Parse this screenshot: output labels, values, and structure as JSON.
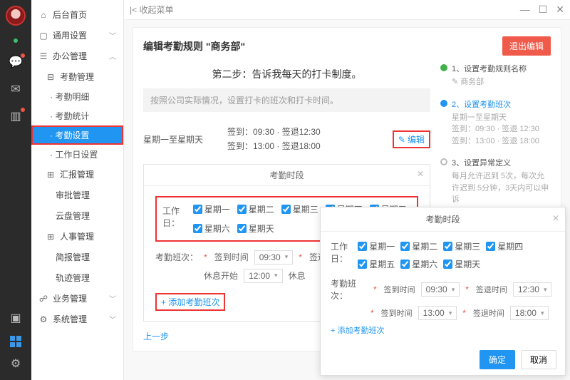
{
  "titlebar": {
    "app": "|< 收起菜单"
  },
  "rail": {
    "icons": [
      "chat",
      "mail",
      "stats"
    ],
    "bottom": [
      "user",
      "apps",
      "gear"
    ]
  },
  "sidebar": {
    "home": "后台首页",
    "groups": [
      {
        "label": "通用设置",
        "icon": "▢",
        "open": false
      },
      {
        "label": "办公管理",
        "icon": "☰",
        "open": true,
        "children": [
          {
            "label": "考勤管理",
            "icon": "⊕",
            "open": true,
            "subs": [
              {
                "label": "· 考勤明细"
              },
              {
                "label": "· 考勤统计"
              },
              {
                "label": "· 考勤设置",
                "active": true
              },
              {
                "label": "· 工作日设置"
              }
            ]
          },
          {
            "label": "汇报管理",
            "icon": "⊕"
          },
          {
            "label": "审批管理"
          },
          {
            "label": "云盘管理"
          },
          {
            "label": "人事管理",
            "icon": "⊕"
          },
          {
            "label": "简报管理"
          },
          {
            "label": "轨迹管理"
          }
        ]
      },
      {
        "label": "业务管理",
        "icon": "☍",
        "open": false
      },
      {
        "label": "系统管理",
        "icon": "⚙",
        "open": false
      }
    ]
  },
  "panel": {
    "title": "编辑考勤规则 \"商务部\"",
    "exit": "退出编辑",
    "stepTitle": "第二步：告诉我每天的打卡制度。",
    "hint": "按照公司实际情况，设置打卡的班次和打卡时间。",
    "dayRange": "星期一至星期天",
    "times": "签到：09:30 · 签退12:30\n签到：13:00 · 签退18:00",
    "editLabel": "编辑",
    "prev": "上一步"
  },
  "inner": {
    "header": "考勤时段",
    "workdaysLabel": "工作日：",
    "days": [
      "星期一",
      "星期二",
      "星期三",
      "星期四",
      "星期五",
      "星期六",
      "星期天"
    ],
    "shiftLabel": "考勤班次：",
    "signin": "签到时间",
    "signout": "签退",
    "rest": "休息开始",
    "t1": "09:30",
    "t2": "12:00",
    "add": "+ 添加考勤班次"
  },
  "steps": [
    {
      "num": "1、设置考勤规则名称",
      "detail": "✎ 商务部",
      "state": "done"
    },
    {
      "num": "2、设置考勤班次",
      "detail": "星期一至星期天\n签到：09:30 · 签退 12:30\n签到：13:00 · 签退 18:00",
      "state": "cur"
    },
    {
      "num": "3、设置异常定义",
      "detail": "每月允许迟到 5次，每次允许迟到 5分钟，3天内可以申诉\n迟到、早退……",
      "state": ""
    }
  ],
  "modal": {
    "header": "考勤时段",
    "workdaysLabel": "工作日：",
    "days": [
      "星期一",
      "星期二",
      "星期三",
      "星期四",
      "星期五",
      "星期六",
      "星期天"
    ],
    "shiftLabel": "考勤班次：",
    "signin": "签到时间",
    "signout": "签退时间",
    "r1a": "09:30",
    "r1b": "12:30",
    "r2a": "13:00",
    "r2b": "18:00",
    "add": "+ 添加考勤班次",
    "ok": "确定",
    "cancel": "取消"
  }
}
